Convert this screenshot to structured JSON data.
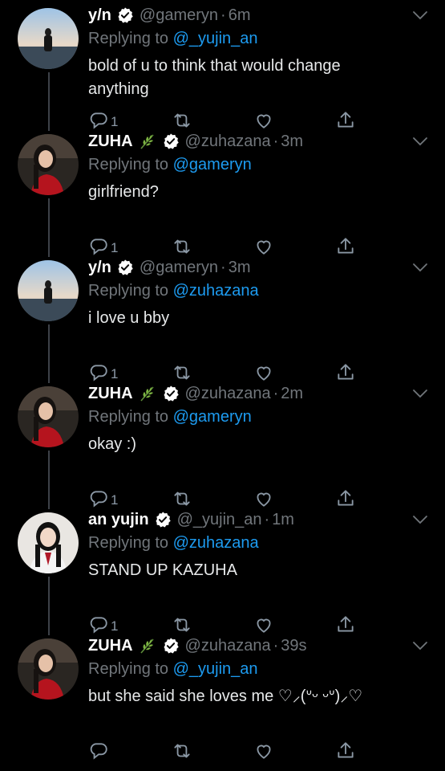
{
  "tweets": [
    {
      "name": "y/n",
      "leaf": false,
      "handle": "@gameryn",
      "time": "6m",
      "reply_prefix": "Replying to ",
      "mention": "@_yujin_an",
      "text": "bold of u to think that would change anything",
      "reply_count": "1",
      "avatar": "sky"
    },
    {
      "name": "ZUHA",
      "leaf": true,
      "handle": "@zuhazana",
      "time": "3m",
      "reply_prefix": "Replying to ",
      "mention": "@gameryn",
      "text": "girlfriend?",
      "reply_count": "1",
      "avatar": "girl-red"
    },
    {
      "name": "y/n",
      "leaf": false,
      "handle": "@gameryn",
      "time": "3m",
      "reply_prefix": "Replying to ",
      "mention": "@zuhazana",
      "text": "i love u bby",
      "reply_count": "1",
      "avatar": "sky"
    },
    {
      "name": "ZUHA",
      "leaf": true,
      "handle": "@zuhazana",
      "time": "2m",
      "reply_prefix": "Replying to ",
      "mention": "@gameryn",
      "text": "okay :)",
      "reply_count": "1",
      "avatar": "girl-red"
    },
    {
      "name": "an yujin",
      "leaf": false,
      "handle": "@_yujin_an",
      "time": "1m",
      "reply_prefix": "Replying to ",
      "mention": "@zuhazana",
      "text": "STAND UP KAZUHA",
      "reply_count": "1",
      "avatar": "girl-uniform"
    },
    {
      "name": "ZUHA",
      "leaf": true,
      "handle": "@zuhazana",
      "time": "39s",
      "reply_prefix": "Replying to ",
      "mention": "@_yujin_an",
      "text": "but she said she loves me ♡⸝(ᐡᵕ ᵕᐡ)⸝♡",
      "reply_count": "",
      "avatar": "girl-red"
    }
  ],
  "separator": "·",
  "icons": {
    "reply": "reply-icon",
    "retweet": "retweet-icon",
    "like": "heart-icon",
    "share": "share-icon",
    "verified": "verified-badge-icon",
    "leaf": "leaf-emoji-icon",
    "chevron": "chevron-down-icon"
  },
  "colors": {
    "mention": "#1d9bf0",
    "muted": "#71767b",
    "background": "#000000"
  }
}
